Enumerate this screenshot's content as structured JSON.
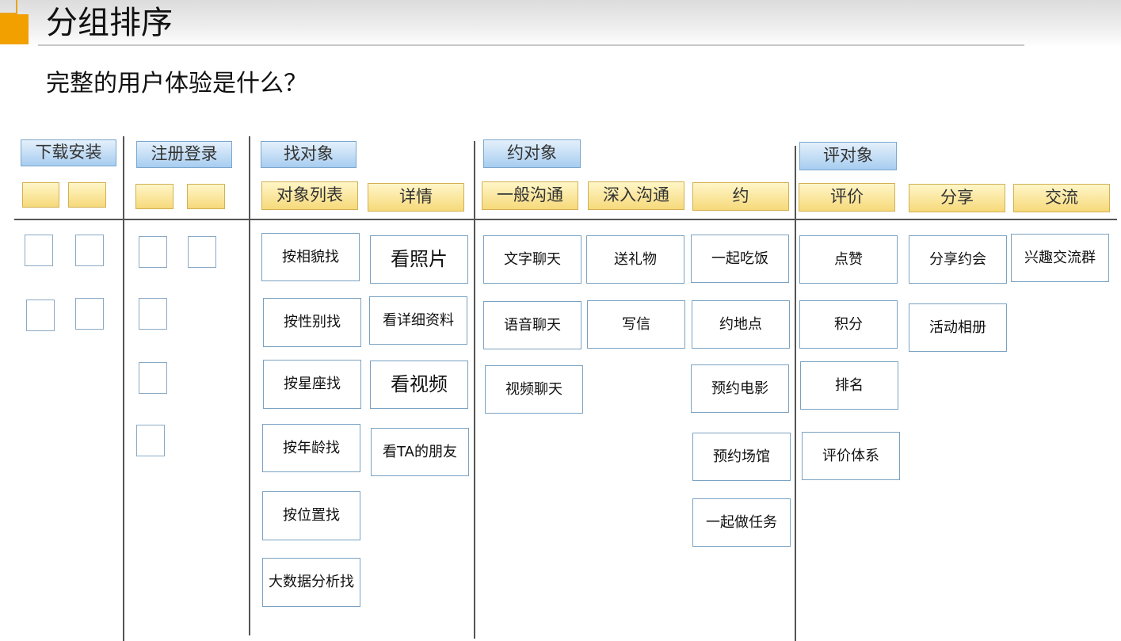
{
  "header": {
    "title": "分组排序",
    "subtitle": "完整的用户体验是什么？"
  },
  "stages": {
    "download": "下载安装",
    "register": "注册登录",
    "find": "找对象",
    "date": "约对象",
    "review": "评对象"
  },
  "groups": {
    "list": "对象列表",
    "detail": "详情",
    "chat": "一般沟通",
    "deep": "深入沟通",
    "meet": "约",
    "rate": "评价",
    "share": "分享",
    "exchange": "交流"
  },
  "items": {
    "by_looks": "按相貌找",
    "by_gender": "按性别找",
    "by_zodiac": "按星座找",
    "by_age": "按年龄找",
    "by_location": "按位置找",
    "by_bigdata": "大数据分析找",
    "photos": "看照片",
    "profile": "看详细资料",
    "video": "看视频",
    "friends": "看TA的朋友",
    "text_chat": "文字聊天",
    "voice_chat": "语音聊天",
    "video_chat": "视频聊天",
    "gift": "送礼物",
    "letter": "写信",
    "dinner": "一起吃饭",
    "place": "约地点",
    "movie": "预约电影",
    "venue": "预约场馆",
    "task": "一起做任务",
    "like": "点赞",
    "points": "积分",
    "ranking": "排名",
    "rating_system": "评价体系",
    "share_date": "分享约会",
    "album": "活动相册",
    "interest_group": "兴趣交流群"
  }
}
